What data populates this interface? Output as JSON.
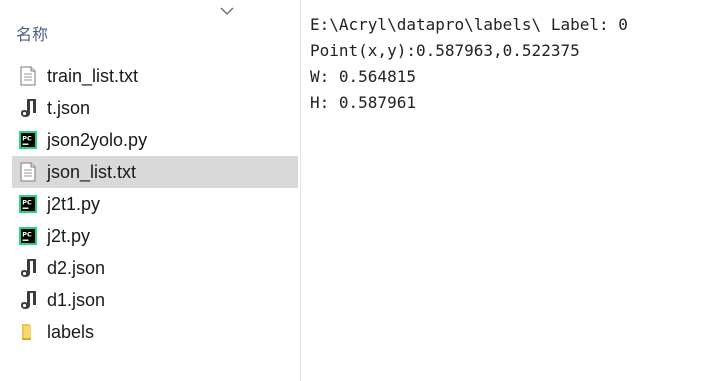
{
  "header": {
    "name_label": "名称"
  },
  "files": [
    {
      "name": "train_list.txt",
      "icon": "text-file-icon",
      "selected": false
    },
    {
      "name": "t.json",
      "icon": "json-file-icon",
      "selected": false
    },
    {
      "name": "json2yolo.py",
      "icon": "pycharm-file-icon",
      "selected": false
    },
    {
      "name": "json_list.txt",
      "icon": "text-file-icon",
      "selected": true
    },
    {
      "name": "j2t1.py",
      "icon": "pycharm-file-icon",
      "selected": false
    },
    {
      "name": "j2t.py",
      "icon": "pycharm-file-icon",
      "selected": false
    },
    {
      "name": "d2.json",
      "icon": "json-file-icon",
      "selected": false
    },
    {
      "name": "d1.json",
      "icon": "json-file-icon",
      "selected": false
    },
    {
      "name": "labels",
      "icon": "folder-icon",
      "selected": false
    }
  ],
  "output": {
    "lines": [
      "E:\\Acryl\\datapro\\labels\\ Label: 0",
      "Point(x,y):0.587963,0.522375",
      "W: 0.564815",
      "H: 0.587961"
    ]
  },
  "colors": {
    "header_text": "#4d6082",
    "selected_row": "#d9d9d9",
    "folder": "#f0c24f",
    "pycharm_green": "#21d789"
  }
}
